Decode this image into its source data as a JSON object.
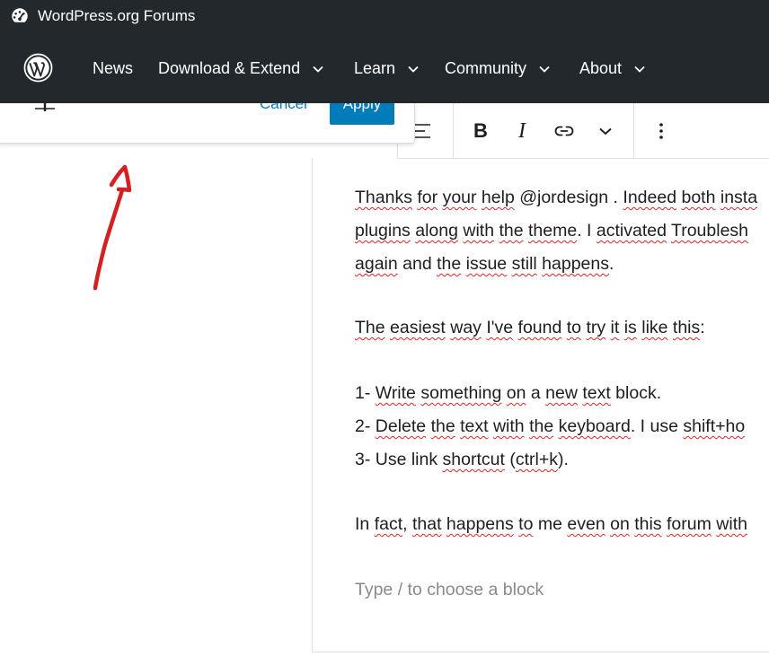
{
  "topbar": {
    "site_icon": "dashboard-gauge-icon",
    "title": "WordPress.org Forums"
  },
  "nav": {
    "logo": "wordpress-logo-icon",
    "items": [
      {
        "label": "News",
        "has_dropdown": false
      },
      {
        "label": "Download & Extend",
        "has_dropdown": true
      },
      {
        "label": "Learn",
        "has_dropdown": true
      },
      {
        "label": "Community",
        "has_dropdown": true
      },
      {
        "label": "About",
        "has_dropdown": true
      }
    ]
  },
  "link_popover": {
    "settings_icon": "sliders-icon",
    "cancel_label": "Cancel",
    "apply_label": "Apply"
  },
  "toolbar": {
    "align_icon": "align-lines-icon",
    "bold_label": "B",
    "italic_label": "I",
    "link_icon": "link-icon",
    "more_icon": "chevron-down-icon",
    "options_icon": "vertical-ellipsis-icon"
  },
  "content": {
    "paragraphs": [
      {
        "lines": [
          [
            {
              "t": "Thanks",
              "s": true
            },
            {
              "t": " ",
              "s": false
            },
            {
              "t": "for",
              "s": true
            },
            {
              "t": " ",
              "s": false
            },
            {
              "t": "your",
              "s": true
            },
            {
              "t": " ",
              "s": false
            },
            {
              "t": "help",
              "s": true
            },
            {
              "t": " @jordesign . ",
              "s": false
            },
            {
              "t": "Indeed",
              "s": true
            },
            {
              "t": " ",
              "s": false
            },
            {
              "t": "both",
              "s": true
            },
            {
              "t": " ",
              "s": false
            },
            {
              "t": "insta",
              "s": true
            }
          ],
          [
            {
              "t": "plugins",
              "s": true
            },
            {
              "t": " ",
              "s": false
            },
            {
              "t": "along",
              "s": true
            },
            {
              "t": " ",
              "s": false
            },
            {
              "t": "with",
              "s": true
            },
            {
              "t": " ",
              "s": false
            },
            {
              "t": "the",
              "s": true
            },
            {
              "t": " ",
              "s": false
            },
            {
              "t": "theme",
              "s": true
            },
            {
              "t": ". I ",
              "s": false
            },
            {
              "t": "activated",
              "s": true
            },
            {
              "t": " ",
              "s": false
            },
            {
              "t": "Troublesh",
              "s": true
            }
          ],
          [
            {
              "t": "again",
              "s": true
            },
            {
              "t": " and ",
              "s": false
            },
            {
              "t": "the",
              "s": true
            },
            {
              "t": " ",
              "s": false
            },
            {
              "t": "issue",
              "s": true
            },
            {
              "t": " ",
              "s": false
            },
            {
              "t": "still",
              "s": true
            },
            {
              "t": " ",
              "s": false
            },
            {
              "t": "happens",
              "s": true
            },
            {
              "t": ".",
              "s": false
            }
          ]
        ]
      },
      {
        "lines": [
          [
            {
              "t": "The",
              "s": true
            },
            {
              "t": " ",
              "s": false
            },
            {
              "t": "easiest",
              "s": true
            },
            {
              "t": " ",
              "s": false
            },
            {
              "t": "way",
              "s": true
            },
            {
              "t": " ",
              "s": false
            },
            {
              "t": "I've",
              "s": true
            },
            {
              "t": " ",
              "s": false
            },
            {
              "t": "found",
              "s": true
            },
            {
              "t": " ",
              "s": false
            },
            {
              "t": "to",
              "s": true
            },
            {
              "t": " ",
              "s": false
            },
            {
              "t": "try",
              "s": true
            },
            {
              "t": " ",
              "s": false
            },
            {
              "t": "it",
              "s": true
            },
            {
              "t": " ",
              "s": false
            },
            {
              "t": "is",
              "s": true
            },
            {
              "t": " ",
              "s": false
            },
            {
              "t": "like",
              "s": true
            },
            {
              "t": " ",
              "s": false
            },
            {
              "t": "this",
              "s": true
            },
            {
              "t": ":",
              "s": false
            }
          ]
        ]
      },
      {
        "lines": [
          [
            {
              "t": "1- ",
              "s": false
            },
            {
              "t": "Write",
              "s": true
            },
            {
              "t": " ",
              "s": false
            },
            {
              "t": "something",
              "s": true
            },
            {
              "t": " ",
              "s": false
            },
            {
              "t": "on",
              "s": true
            },
            {
              "t": " a ",
              "s": false
            },
            {
              "t": "new",
              "s": true
            },
            {
              "t": " ",
              "s": false
            },
            {
              "t": "text",
              "s": true
            },
            {
              "t": " block.",
              "s": false
            }
          ],
          [
            {
              "t": "2- ",
              "s": false
            },
            {
              "t": "Delete",
              "s": true
            },
            {
              "t": " ",
              "s": false
            },
            {
              "t": "the",
              "s": true
            },
            {
              "t": " ",
              "s": false
            },
            {
              "t": "text",
              "s": true
            },
            {
              "t": " ",
              "s": false
            },
            {
              "t": "with",
              "s": true
            },
            {
              "t": " ",
              "s": false
            },
            {
              "t": "the",
              "s": true
            },
            {
              "t": " ",
              "s": false
            },
            {
              "t": "keyboard",
              "s": true
            },
            {
              "t": ". I use ",
              "s": false
            },
            {
              "t": "shift+ho",
              "s": true
            }
          ],
          [
            {
              "t": "3- Use link ",
              "s": false
            },
            {
              "t": "shortcut",
              "s": true
            },
            {
              "t": " (",
              "s": false
            },
            {
              "t": "ctrl+k",
              "s": true
            },
            {
              "t": ").",
              "s": false
            }
          ]
        ]
      },
      {
        "lines": [
          [
            {
              "t": "In ",
              "s": false
            },
            {
              "t": "fact",
              "s": true
            },
            {
              "t": ", ",
              "s": false
            },
            {
              "t": "that",
              "s": true
            },
            {
              "t": " ",
              "s": false
            },
            {
              "t": "happens",
              "s": true
            },
            {
              "t": " ",
              "s": false
            },
            {
              "t": "to",
              "s": true
            },
            {
              "t": " me ",
              "s": false
            },
            {
              "t": "even",
              "s": true
            },
            {
              "t": " ",
              "s": false
            },
            {
              "t": "on",
              "s": true
            },
            {
              "t": " ",
              "s": false
            },
            {
              "t": "this",
              "s": true
            },
            {
              "t": " ",
              "s": false
            },
            {
              "t": "forum",
              "s": true
            },
            {
              "t": " ",
              "s": false
            },
            {
              "t": "with",
              "s": true
            }
          ]
        ]
      }
    ],
    "placeholder": "Type / to choose a block"
  },
  "annotation": {
    "shape": "red-hand-drawn-arrow",
    "color": "#d42020"
  }
}
